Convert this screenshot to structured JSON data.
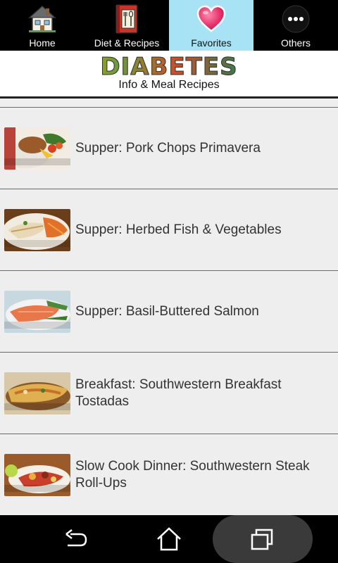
{
  "tabs": [
    {
      "label": "Home",
      "icon": "house-icon"
    },
    {
      "label": "Diet & Recipes",
      "icon": "recipe-book-icon"
    },
    {
      "label": "Favorites",
      "icon": "heart-icon",
      "active": true
    },
    {
      "label": "Others",
      "icon": "more-dots-icon"
    }
  ],
  "banner": {
    "title": "DIABETES",
    "subtitle": "Info & Meal Recipes"
  },
  "recipes": [
    {
      "title": "Supper: Pork Chops Primavera",
      "thumb_caption": "Pork Chops Primavera"
    },
    {
      "title": "Supper: Herbed Fish & Vegetables",
      "thumb_caption": "Herbed Fish & Vegetables"
    },
    {
      "title": "Supper: Basil-Buttered Salmon",
      "thumb_caption": "Basil-Buttered Salmon"
    },
    {
      "title": "Breakfast: Southwestern Breakfast Tostadas",
      "thumb_caption": "Southwestern Breakfast Tostadas"
    },
    {
      "title": "Slow Cook Dinner: Southwestern Steak Roll-Ups",
      "thumb_caption": "Southwestern Steak Roll-Ups"
    }
  ],
  "nav": {
    "back_icon": "back-arrow-icon",
    "home_icon": "home-outline-icon",
    "recent_icon": "recent-apps-icon"
  },
  "colors": {
    "active_tab": "#a8e3f5",
    "list_bg": "#eeeeee",
    "heart": "#e8336d"
  }
}
